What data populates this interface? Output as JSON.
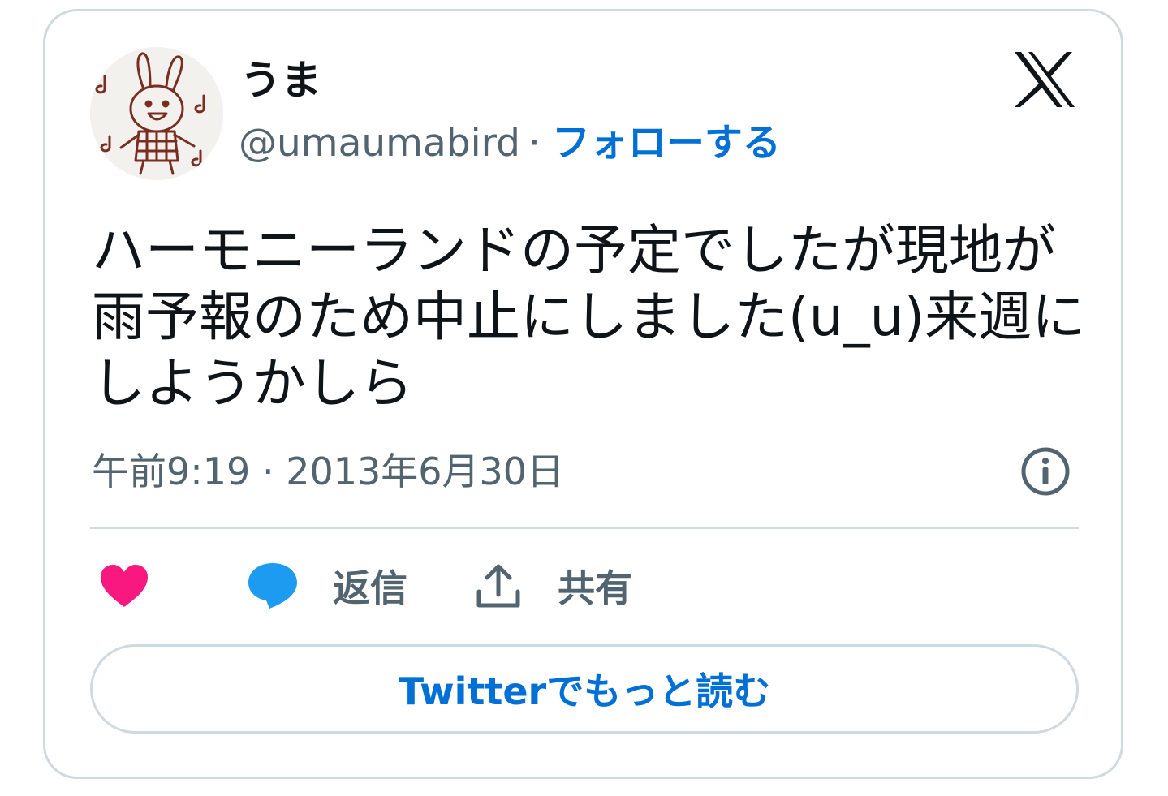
{
  "author": {
    "display_name": "うま",
    "handle": "@umaumabird",
    "separator": "·",
    "follow_label": "フォローする",
    "avatar_icon": "bunny-drawing-avatar"
  },
  "brand": {
    "logo_icon": "x-logo-icon"
  },
  "tweet": {
    "text": "ハーモニーランドの予定でしたが現地が雨予報のため中止にしました(u_u)来週にしようかしら",
    "time": "午前9:19",
    "separator": "·",
    "date": "2013年6月30日"
  },
  "actions": {
    "like_icon": "heart-icon",
    "reply_label": "返信",
    "share_label": "共有"
  },
  "read_more_label": "Twitterでもっと読む",
  "colors": {
    "link_blue": "#006fd6",
    "heart_pink": "#f91880",
    "reply_blue": "#1d9bf0",
    "secondary_text": "#536471",
    "border": "#cfd9de"
  }
}
